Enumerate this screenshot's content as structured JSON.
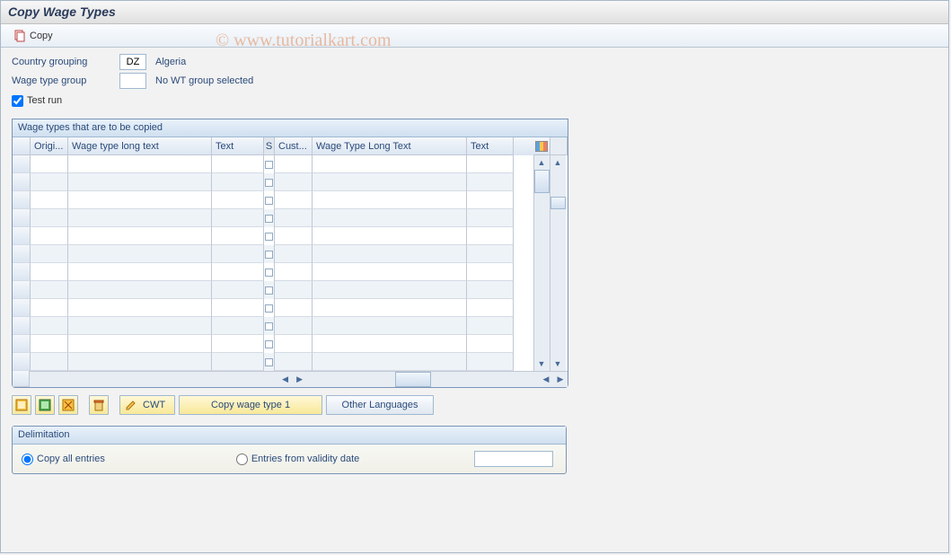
{
  "title": "Copy Wage Types",
  "toolbar": {
    "copy_label": "Copy"
  },
  "watermark": "© www.tutorialkart.com",
  "fields": {
    "country_grouping_label": "Country grouping",
    "country_grouping_value": "DZ",
    "country_grouping_text": "Algeria",
    "wage_type_group_label": "Wage type group",
    "wage_type_group_value": "",
    "wage_type_group_text": "No WT group selected",
    "test_run_label": "Test run",
    "test_run_checked": true
  },
  "table": {
    "heading": "Wage types that are to be copied",
    "columns": {
      "origi": "Origi...",
      "wage_long": "Wage type long text",
      "text": "Text",
      "s": "S",
      "cust": "Cust...",
      "wage_long2": "Wage Type Long Text",
      "text2": "Text"
    },
    "row_count": 12
  },
  "buttons": {
    "cwt": "CWT",
    "copy_wt1": "Copy wage type 1",
    "other_lang": "Other Languages"
  },
  "delimitation": {
    "heading": "Delimitation",
    "copy_all": "Copy all entries",
    "entries_from": "Entries from validity date",
    "selected": "copy_all",
    "date_value": ""
  }
}
